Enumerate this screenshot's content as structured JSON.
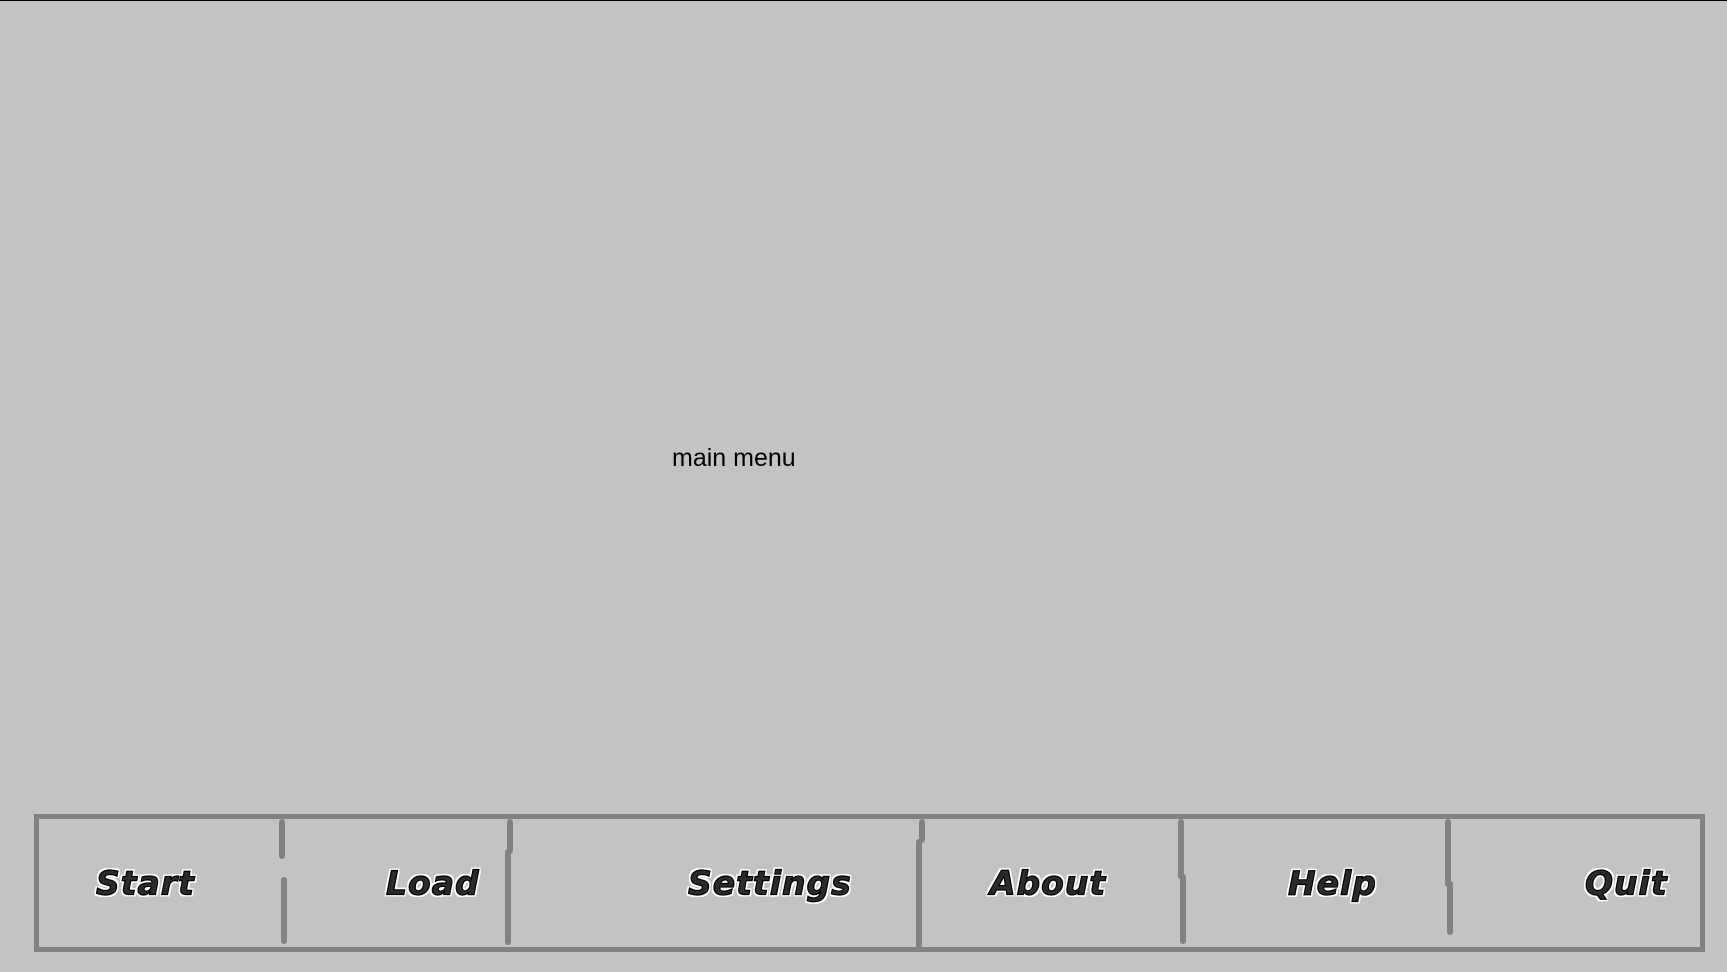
{
  "screen": {
    "title": "main menu"
  },
  "menu": {
    "items": [
      {
        "id": "start",
        "label": "Start"
      },
      {
        "id": "load",
        "label": "Load"
      },
      {
        "id": "settings",
        "label": "Settings"
      },
      {
        "id": "about",
        "label": "About"
      },
      {
        "id": "help",
        "label": "Help"
      },
      {
        "id": "quit",
        "label": "Quit"
      }
    ]
  },
  "colors": {
    "background": "#c3c3c3",
    "frame": "#828282",
    "label_fill": "#2b2b2b",
    "label_outline": "#ffffff"
  }
}
